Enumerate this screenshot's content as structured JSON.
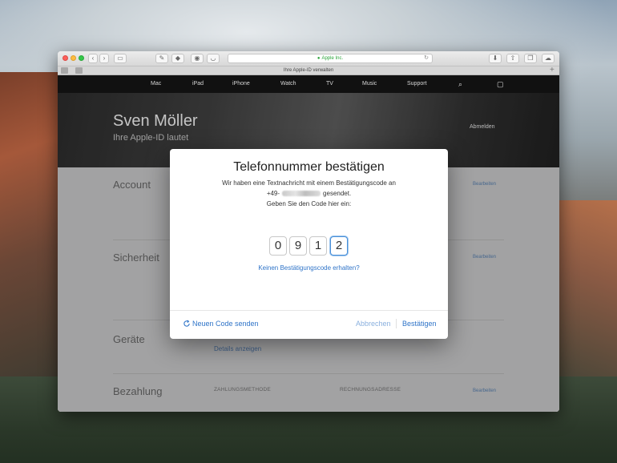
{
  "browser": {
    "url_display": "Apple Inc.",
    "tab_title": "Ihre Apple-ID verwalten",
    "tab_plus": "+"
  },
  "nav": {
    "items": [
      "Mac",
      "iPad",
      "iPhone",
      "Watch",
      "TV",
      "Music",
      "Support"
    ]
  },
  "hero": {
    "name": "Sven Möller",
    "subtitle": "Ihre Apple-ID lautet",
    "signout_label": "Abmelden"
  },
  "sections": {
    "account": {
      "title": "Account",
      "edit": "Bearbeiten"
    },
    "security": {
      "title": "Sicherheit",
      "edit": "Bearbeiten"
    },
    "devices": {
      "title": "Geräte",
      "link": "Details anzeigen"
    },
    "payment": {
      "title": "Bezahlung",
      "col_method": "ZAHLUNGSMETHODE",
      "col_address": "RECHNUNGSADRESSE",
      "edit": "Bearbeiten"
    }
  },
  "modal": {
    "title": "Telefonnummer bestätigen",
    "line1": "Wir haben eine Textnachricht mit einem Bestätigungscode an",
    "phone_prefix": "+49-",
    "phone_suffix": "gesendet.",
    "line3": "Geben Sie den Code hier ein:",
    "digits": [
      "0",
      "9",
      "1",
      "2"
    ],
    "no_code_link": "Keinen Bestätigungscode erhalten?",
    "resend_label": "Neuen Code senden",
    "cancel_label": "Abbrechen",
    "confirm_label": "Bestätigen"
  },
  "colors": {
    "accent": "#2f74c8",
    "nav_bg": "#111111"
  }
}
